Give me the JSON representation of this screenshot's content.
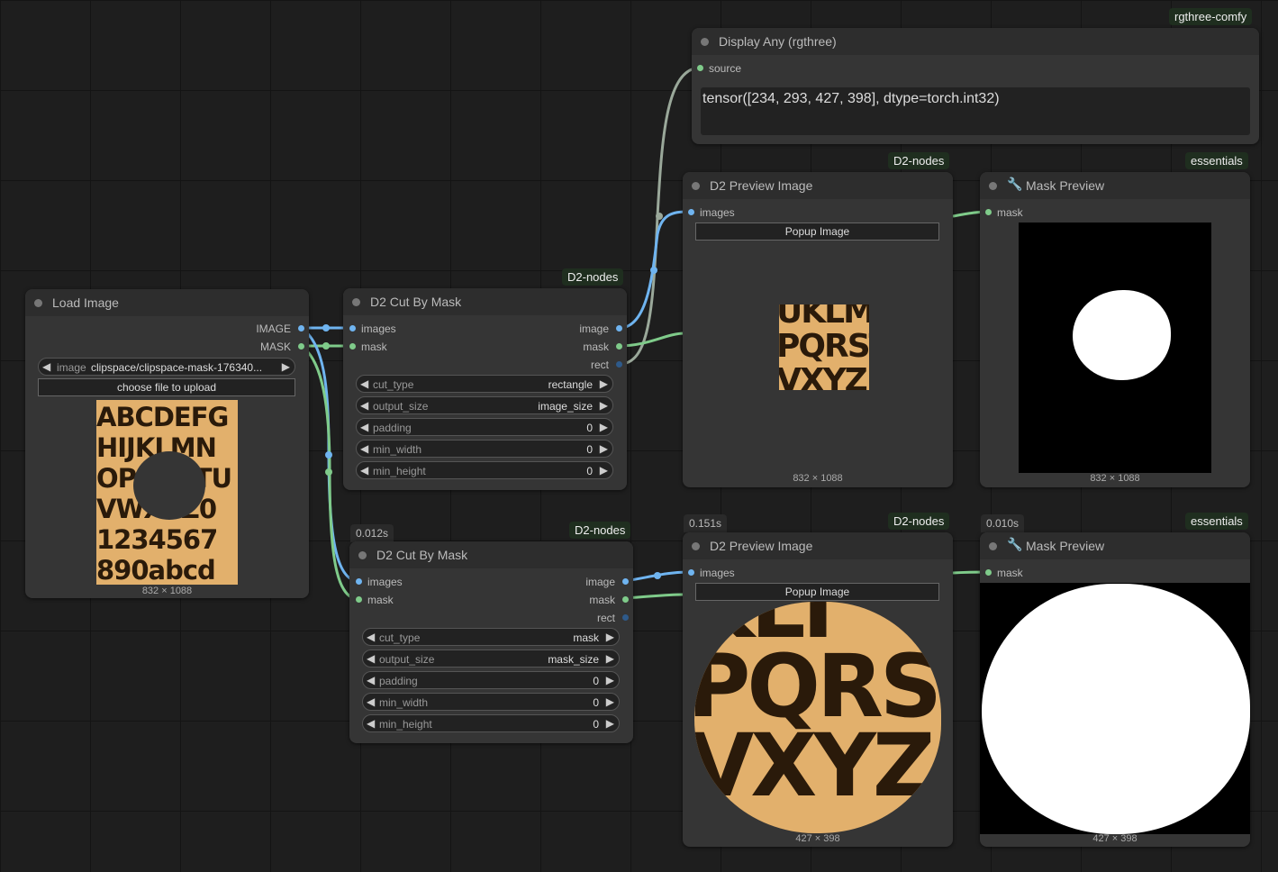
{
  "canvas": {
    "background": "#1e1e1e"
  },
  "colors": {
    "image_wire": "#6fb4f0",
    "mask_wire": "#7fcb8a",
    "rect_wire": "#9aa89a"
  },
  "badges": {
    "rgthree": "rgthree-comfy",
    "d2": "D2-nodes",
    "essentials": "essentials"
  },
  "load_image": {
    "title": "Load Image",
    "outputs": [
      "IMAGE",
      "MASK"
    ],
    "widget_name": "image",
    "widget_value": "clipspace/clipspace-mask-176340...",
    "upload_button": "choose file to upload",
    "preview_lines": [
      "ABCDEFG",
      "HIJKLMN",
      "OPQRSTU",
      "VWXYZ0",
      "1234567",
      "890abcd"
    ],
    "dimensions": "832 × 1088"
  },
  "cut1": {
    "title": "D2 Cut By Mask",
    "inputs": [
      "images",
      "mask"
    ],
    "outputs": [
      "image",
      "mask",
      "rect"
    ],
    "widgets": [
      {
        "name": "cut_type",
        "value": "rectangle"
      },
      {
        "name": "output_size",
        "value": "image_size"
      },
      {
        "name": "padding",
        "value": "0"
      },
      {
        "name": "min_width",
        "value": "0"
      },
      {
        "name": "min_height",
        "value": "0"
      }
    ]
  },
  "cut2": {
    "time": "0.012s",
    "title": "D2 Cut By Mask",
    "inputs": [
      "images",
      "mask"
    ],
    "outputs": [
      "image",
      "mask",
      "rect"
    ],
    "widgets": [
      {
        "name": "cut_type",
        "value": "mask"
      },
      {
        "name": "output_size",
        "value": "mask_size"
      },
      {
        "name": "padding",
        "value": "0"
      },
      {
        "name": "min_width",
        "value": "0"
      },
      {
        "name": "min_height",
        "value": "0"
      }
    ]
  },
  "display_any": {
    "title": "Display Any (rgthree)",
    "input": "source",
    "value": "tensor([234, 293, 427, 398], dtype=torch.int32)"
  },
  "preview1": {
    "title": "D2 Preview Image",
    "input": "images",
    "button": "Popup Image",
    "crop_lines": [
      "UKLM",
      "PQRST",
      "VXYZ"
    ],
    "dimensions": "832 × 1088"
  },
  "mask_preview1": {
    "title": "Mask Preview",
    "input": "mask",
    "dimensions": "832 × 1088"
  },
  "preview2": {
    "time": "0.151s",
    "title": "D2 Preview Image",
    "input": "images",
    "button": "Popup Image",
    "crop_lines": [
      "KLI",
      "PQRST",
      "VXYZ"
    ],
    "dimensions": "427 × 398"
  },
  "mask_preview2": {
    "time": "0.010s",
    "title": "Mask Preview",
    "input": "mask",
    "dimensions": "427 × 398"
  }
}
